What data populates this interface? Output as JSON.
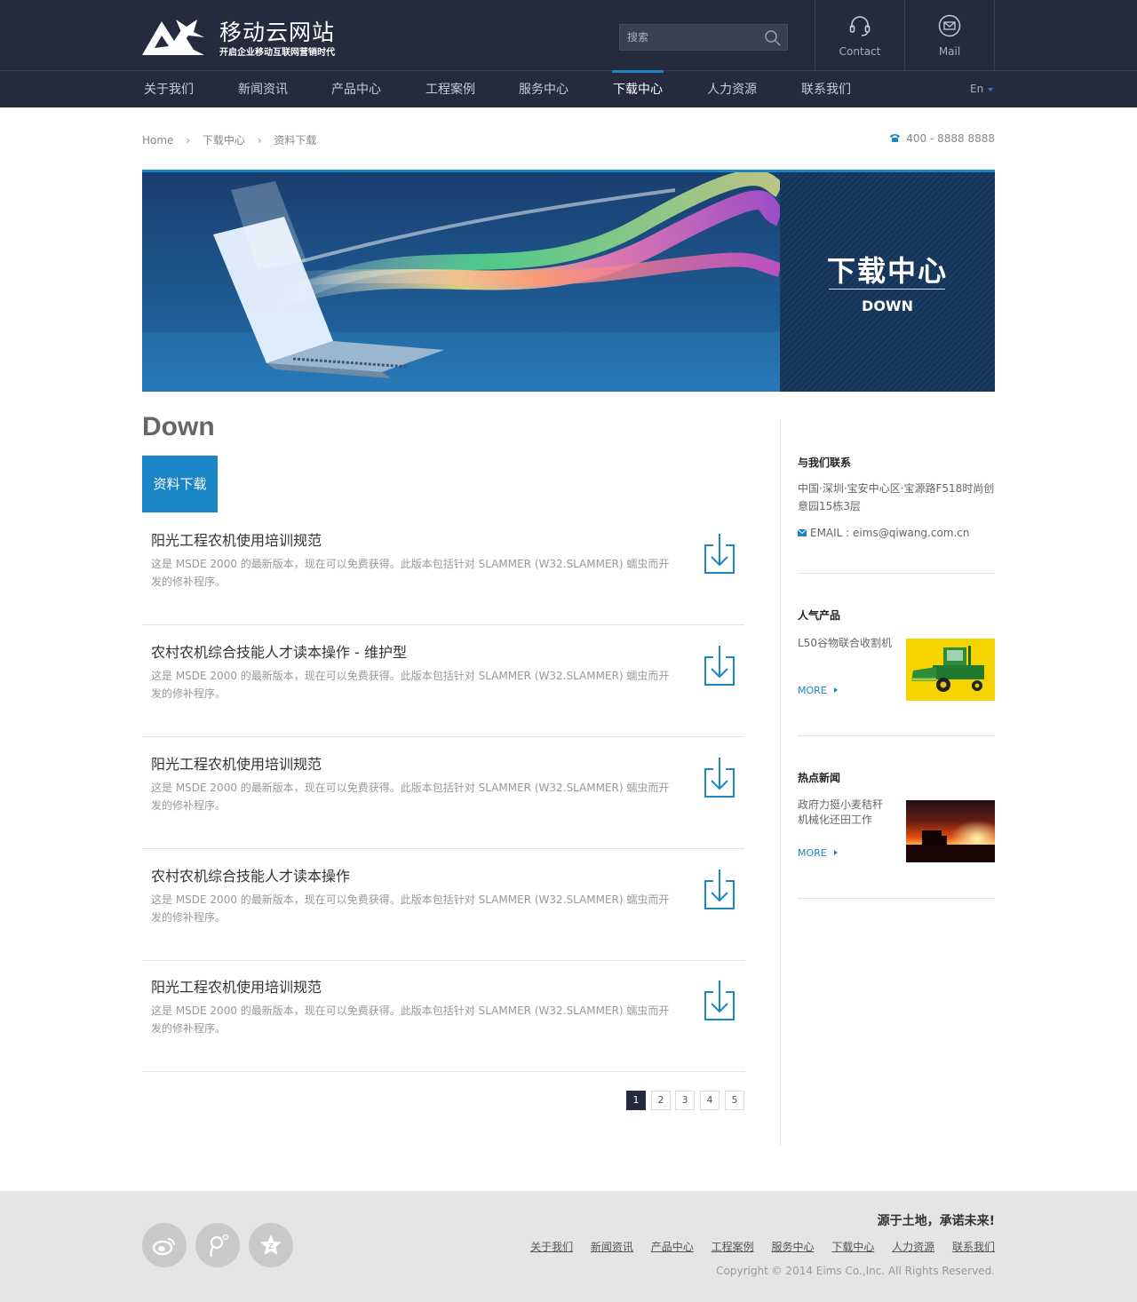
{
  "header": {
    "logo_title": "移动云网站",
    "logo_subtitle": "开启企业移动互联网营销时代",
    "search_placeholder": "搜索",
    "contact_label": "Contact",
    "mail_label": "Mail",
    "lang": "En"
  },
  "nav": {
    "items": [
      {
        "label": "关于我们"
      },
      {
        "label": "新闻资讯"
      },
      {
        "label": "产品中心"
      },
      {
        "label": "工程案例"
      },
      {
        "label": "服务中心"
      },
      {
        "label": "下载中心",
        "active": true
      },
      {
        "label": "人力资源"
      },
      {
        "label": "联系我们"
      }
    ]
  },
  "breadcrumb": {
    "items": [
      "Home",
      "下载中心",
      "资料下载"
    ],
    "phone": "400 - 8888 8888"
  },
  "banner": {
    "title_cn": "下载中心",
    "title_en": "DOWN"
  },
  "main": {
    "heading": "Down",
    "active_tab": "资料下载",
    "items": [
      {
        "title": "阳光工程农机使用培训规范",
        "desc": "这是 MSDE 2000 的最新版本，现在可以免费获得。此版本包括针对 SLAMMER (W32.SLAMMER) 蠕虫而开发的修补程序。"
      },
      {
        "title": "农村农机综合技能人才读本操作 - 维护型",
        "desc": "这是 MSDE 2000 的最新版本，现在可以免费获得。此版本包括针对 SLAMMER (W32.SLAMMER) 蠕虫而开发的修补程序。"
      },
      {
        "title": "阳光工程农机使用培训规范",
        "desc": "这是 MSDE 2000 的最新版本，现在可以免费获得。此版本包括针对 SLAMMER (W32.SLAMMER) 蠕虫而开发的修补程序。"
      },
      {
        "title": "农村农机综合技能人才读本操作",
        "desc": "这是 MSDE 2000 的最新版本，现在可以免费获得。此版本包括针对 SLAMMER (W32.SLAMMER) 蠕虫而开发的修补程序。"
      },
      {
        "title": "阳光工程农机使用培训规范",
        "desc": "这是 MSDE 2000 的最新版本，现在可以免费获得。此版本包括针对 SLAMMER (W32.SLAMMER) 蠕虫而开发的修补程序。"
      }
    ],
    "pages": [
      "1",
      "2",
      "3",
      "4",
      "5"
    ],
    "current_page": "1"
  },
  "sidebar": {
    "contact": {
      "heading": "与我们联系",
      "address": "中国·深圳·宝安中心区·宝源路F518时尚创意园15栋3层",
      "email": "EMAIL : eims@qiwang.com.cn"
    },
    "products": {
      "heading": "人气产品",
      "item": "L50谷物联合收割机",
      "more": "MORE"
    },
    "news": {
      "heading": "热点新闻",
      "item": "政府力挺小麦秸秆机械化还田工作",
      "more": "MORE"
    }
  },
  "footer": {
    "social_icons": [
      "weibo-icon",
      "tencent-weibo-icon",
      "favorite-star-icon"
    ],
    "slogan": "源于土地，承诺未来!",
    "links": [
      "关于我们",
      "新闻资讯",
      "产品中心",
      "工程案例",
      "服务中心",
      "下载中心",
      "人力资源",
      "联系我们"
    ],
    "copyright": "Copyright © 2014  Eims Co.,Inc. All Rights Reserved."
  },
  "colors": {
    "header_bg": "#252a3e",
    "accent": "#1a86c8",
    "footer_bg": "#e5e5e5"
  }
}
